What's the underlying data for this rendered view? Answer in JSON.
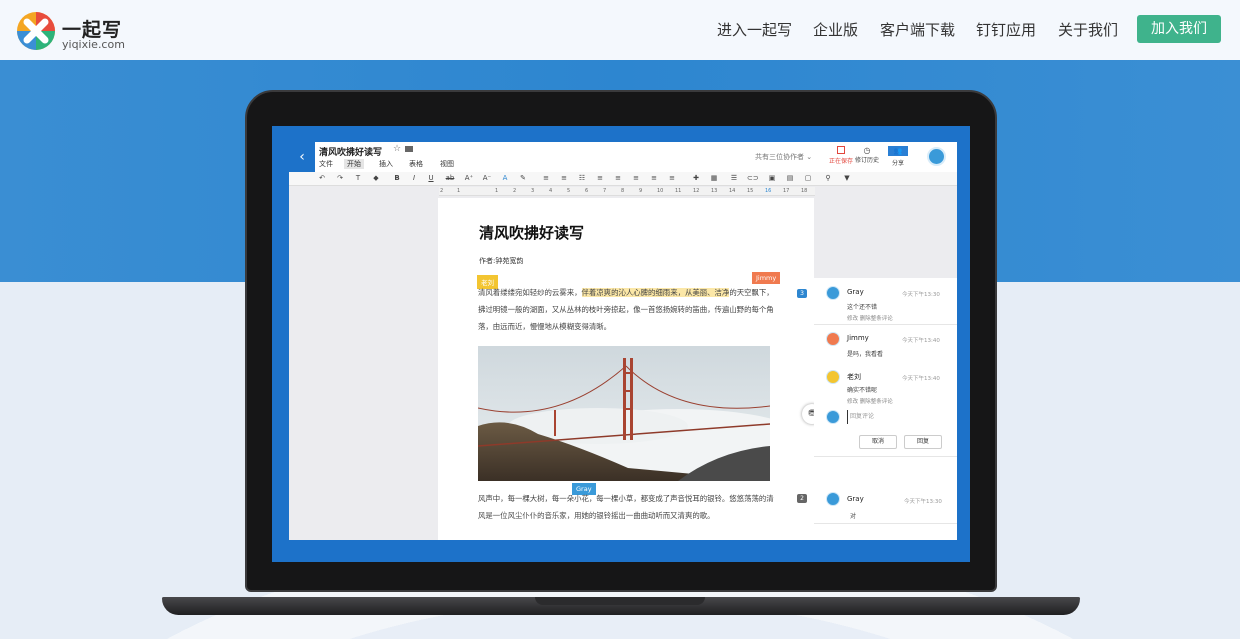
{
  "nav": {
    "logo_name": "一起写",
    "logo_domain": "yiqixie.com",
    "items": [
      "进入一起写",
      "企业版",
      "客户端下载",
      "钉钉应用",
      "关于我们"
    ],
    "join_label": "加入我们"
  },
  "app": {
    "doc_title": "清风吹拂好读写",
    "star": "☆",
    "menus": [
      "文件",
      "开始",
      "插入",
      "表格",
      "视图"
    ],
    "active_menu": "开始",
    "collaborators_label": "共有三位协作者",
    "save_label": "正在保存",
    "history_label": "修订历史",
    "share_label": "分享",
    "toolbar_icons": [
      "undo-icon",
      "redo-icon",
      "format-painter-icon",
      "eraser-icon",
      "bold-icon",
      "italic-icon",
      "underline-icon",
      "strikethrough-icon",
      "font-size-up-icon",
      "font-size-down-icon",
      "font-color-icon",
      "highlight-icon",
      "ordered-list-icon",
      "bullet-list-icon",
      "checklist-icon",
      "align-left-icon",
      "align-center-icon",
      "align-right-icon",
      "align-justify-icon",
      "indent-icon",
      "insert-icon",
      "table-icon",
      "hr-icon",
      "link-icon",
      "image-icon",
      "chart-icon",
      "comment-icon",
      "search-icon",
      "help-icon"
    ],
    "ruler_ticks": [
      "2",
      "1",
      "1",
      "2",
      "3",
      "4",
      "5",
      "6",
      "7",
      "8",
      "9",
      "10",
      "11",
      "12",
      "13",
      "14",
      "15",
      "16",
      "17",
      "18"
    ]
  },
  "document": {
    "heading": "清风吹拂好读写",
    "author": "作者:钟苑宽韵",
    "para1_start": "清风",
    "para1_a": "着缕缕宛如轻纱的云雾来，",
    "para1_highlight": "伴着凉爽的沁人心脾的细雨来，从美丽、洁净",
    "para1_rest": "的天空飘下，拂过明镜一般的湖面，又从丛林的枝叶旁掠起，像一首悠扬婉转的笛曲，传遍山野的每个角落，由远而近，慢慢地从模糊变得清晰。",
    "para2": "风声中，每一棵大树，每一朵小花，每一棵小草，都变成了声音悦耳的银铃。悠悠荡荡的清风是一位风尘仆仆的音乐家，用她的银铃摇出一曲曲动听而又清爽的歌。",
    "tag_laoliu": "老刘",
    "tag_jimmy": "Jimmy",
    "tag_gray": "Gray",
    "badge1": "3",
    "badge2": "2"
  },
  "comments": {
    "items": [
      {
        "name": "Gray",
        "time": "今天下午13:30",
        "text": "这个还不错",
        "actions": "修改    删除整条评论"
      },
      {
        "name": "Jimmy",
        "time": "今天下午13:40",
        "text": "是吗，我看看",
        "actions": ""
      },
      {
        "name": "老刘",
        "time": "今天下午13:40",
        "text": "确实不错呢",
        "actions": "修改    删除整条评论"
      }
    ],
    "reply_placeholder": "回复评论",
    "cancel_label": "取消",
    "reply_label": "回复",
    "second": {
      "name": "Gray",
      "time": "今天下午13:30",
      "text": "对"
    }
  },
  "colors": {
    "brand_green": "#3fb38c",
    "blue": "#2d86d0",
    "highlight": "#fbe7a7"
  }
}
